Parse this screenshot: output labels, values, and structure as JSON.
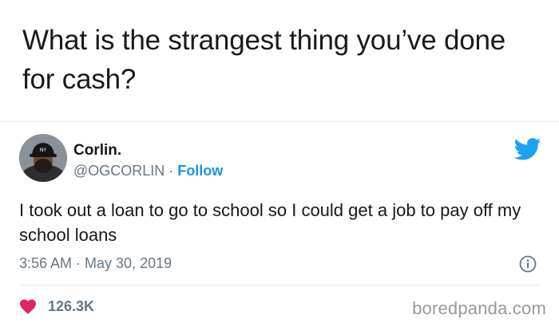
{
  "headline": "What is the strangest thing you’ve done for cash?",
  "tweet": {
    "author_name": "Corlin.",
    "handle": "@OGCORLIN",
    "separator": " · ",
    "follow_label": "Follow",
    "text": "I took out a loan to go to school so I could get a job to pay off my school loans",
    "timestamp": "3:56 AM · May 30, 2019",
    "like_count": "126.3K"
  },
  "watermark": "boredpanda.com",
  "icons": {
    "brand": "twitter-bird-icon",
    "info": "info-icon",
    "like": "heart-icon"
  },
  "colors": {
    "twitter_blue": "#1da1f2",
    "follow_blue": "#1b95e0",
    "heart_pink": "#e0245e",
    "secondary_text": "#657786",
    "primary_text": "#14171a"
  }
}
